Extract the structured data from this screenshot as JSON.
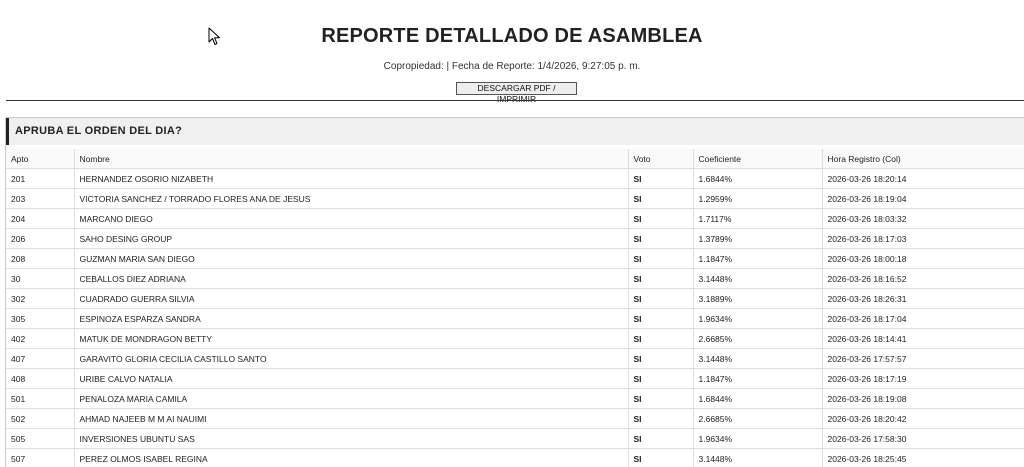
{
  "report": {
    "title": "REPORTE DETALLADO DE ASAMBLEA",
    "subtitle": "Copropiedad: | Fecha de Reporte: 1/4/2026, 9:27:05 p. m.",
    "download_label": "DESCARGAR PDF / IMPRIMIR"
  },
  "section": {
    "question": "APRUBA EL ORDEN DEL DIA?"
  },
  "table": {
    "headers": {
      "apto": "Apto",
      "nombre": "Nombre",
      "voto": "Voto",
      "coeficiente": "Coeficiente",
      "hora": "Hora Registro (Col)"
    },
    "rows": [
      {
        "apto": "201",
        "nombre": "HERNANDEZ OSORIO NIZABETH",
        "voto": "SI",
        "coeficiente": "1.6844%",
        "hora": "2026-03-26 18:20:14"
      },
      {
        "apto": "203",
        "nombre": "VICTORIA SANCHEZ / TORRADO FLORES ANA DE JESUS",
        "voto": "SI",
        "coeficiente": "1.2959%",
        "hora": "2026-03-26 18:19:04"
      },
      {
        "apto": "204",
        "nombre": "MARCANO DIEGO",
        "voto": "SI",
        "coeficiente": "1.7117%",
        "hora": "2026-03-26 18:03:32"
      },
      {
        "apto": "206",
        "nombre": "SAHO DESING GROUP",
        "voto": "SI",
        "coeficiente": "1.3789%",
        "hora": "2026-03-26 18:17:03"
      },
      {
        "apto": "208",
        "nombre": "GUZMAN MARIA SAN DIEGO",
        "voto": "SI",
        "coeficiente": "1.1847%",
        "hora": "2026-03-26 18:00:18"
      },
      {
        "apto": "30",
        "nombre": "CEBALLOS DIEZ ADRIANA",
        "voto": "SI",
        "coeficiente": "3.1448%",
        "hora": "2026-03-26 18:16:52"
      },
      {
        "apto": "302",
        "nombre": "CUADRADO GUERRA SILVIA",
        "voto": "SI",
        "coeficiente": "3.1889%",
        "hora": "2026-03-26 18:26:31"
      },
      {
        "apto": "305",
        "nombre": "ESPINOZA ESPARZA SANDRA",
        "voto": "SI",
        "coeficiente": "1.9634%",
        "hora": "2026-03-26 18:17:04"
      },
      {
        "apto": "402",
        "nombre": "MATUK DE MONDRAGON BETTY",
        "voto": "SI",
        "coeficiente": "2.6685%",
        "hora": "2026-03-26 18:14:41"
      },
      {
        "apto": "407",
        "nombre": "GARAVITO GLORIA CECILIA CASTILLO SANTO",
        "voto": "SI",
        "coeficiente": "3.1448%",
        "hora": "2026-03-26 17:57:57"
      },
      {
        "apto": "408",
        "nombre": "URIBE CALVO NATALIA",
        "voto": "SI",
        "coeficiente": "1.1847%",
        "hora": "2026-03-26 18:17:19"
      },
      {
        "apto": "501",
        "nombre": "PENALOZA MARIA CAMILA",
        "voto": "SI",
        "coeficiente": "1.6844%",
        "hora": "2026-03-26 18:19:08"
      },
      {
        "apto": "502",
        "nombre": "AHMAD NAJEEB M M AI NAUIMI",
        "voto": "SI",
        "coeficiente": "2.6685%",
        "hora": "2026-03-26 18:20:42"
      },
      {
        "apto": "505",
        "nombre": "INVERSIONES UBUNTU SAS",
        "voto": "SI",
        "coeficiente": "1.9634%",
        "hora": "2026-03-26 17:58:30"
      },
      {
        "apto": "507",
        "nombre": "PEREZ OLMOS ISABEL REGINA",
        "voto": "SI",
        "coeficiente": "3.1448%",
        "hora": "2026-03-26 18:25:45"
      }
    ]
  },
  "icons": {
    "cursor": "mouse-pointer-icon"
  }
}
